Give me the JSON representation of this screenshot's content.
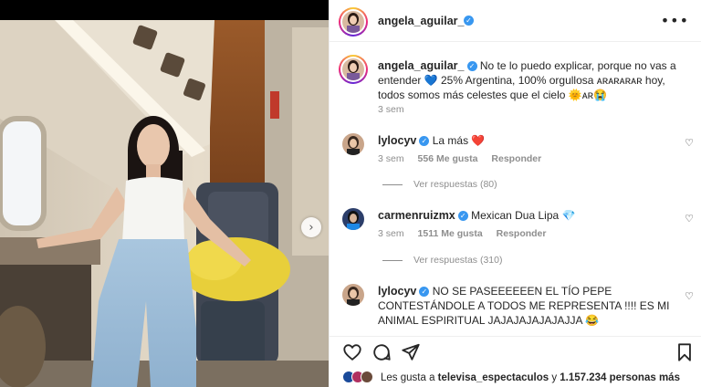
{
  "post": {
    "author": "angela_aguilar_",
    "caption_user": "angela_aguilar_",
    "caption_text": "No te lo puedo explicar, porque no vas a entender 💙 25% Argentina, 100% orgullosa ᴀʀᴀʀᴀʀᴀʀ hoy, todos somos más celestes que el cielo 🌞ᴀʀ😭",
    "caption_time": "3 sem"
  },
  "comments": [
    {
      "user": "lylocyv",
      "text": "La más ❤️",
      "time": "3 sem",
      "likes": "556 Me gusta",
      "reply": "Responder",
      "view_replies": "Ver respuestas (80)"
    },
    {
      "user": "carmenruizmx",
      "text": "Mexican Dua Lipa 💎",
      "time": "3 sem",
      "likes": "1511 Me gusta",
      "reply": "Responder",
      "view_replies": "Ver respuestas (310)"
    },
    {
      "user": "lylocyv",
      "text": "NO SE PASEEEEEEN EL TÍO PEPE CONTESTÁNDOLE A TODOS ME REPRESENTA !!!! ES MI ANIMAL ESPIRITUAL JAJAJAJAJAJAJJA 😂"
    }
  ],
  "likes_bar": {
    "prefix": "Les gusta a ",
    "user": "televisa_espectaculos",
    "middle": " y ",
    "count": "1.157.234 personas más"
  },
  "icons": {
    "more": "more-options-icon",
    "like": "heart-outline-icon",
    "comment": "comment-icon",
    "share": "share-icon",
    "save": "bookmark-icon",
    "next": "chevron-right-icon"
  },
  "colors": {
    "verified": "#3897f0",
    "secondary_text": "#8e8e8e",
    "primary_text": "#262626"
  }
}
